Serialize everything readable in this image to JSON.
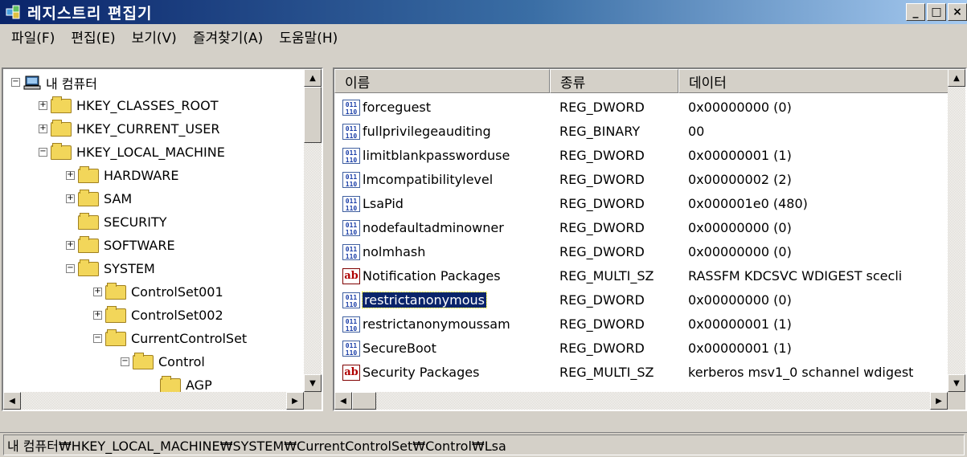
{
  "window": {
    "title": "레지스트리 편집기",
    "buttons": {
      "minimize": "_",
      "maximize": "□",
      "close": "×"
    }
  },
  "menu": [
    "파일(F)",
    "편집(E)",
    "보기(V)",
    "즐겨찾기(A)",
    "도움말(H)"
  ],
  "tree": [
    {
      "label": "내 컴퓨터",
      "expander": "−",
      "icon": "computer-icon",
      "depth": 0
    },
    {
      "label": "HKEY_CLASSES_ROOT",
      "expander": "+",
      "icon": "folder-icon",
      "depth": 1
    },
    {
      "label": "HKEY_CURRENT_USER",
      "expander": "+",
      "icon": "folder-icon",
      "depth": 1
    },
    {
      "label": "HKEY_LOCAL_MACHINE",
      "expander": "−",
      "icon": "folder-icon",
      "depth": 1
    },
    {
      "label": "HARDWARE",
      "expander": "+",
      "icon": "folder-icon",
      "depth": 2
    },
    {
      "label": "SAM",
      "expander": "+",
      "icon": "folder-icon",
      "depth": 2
    },
    {
      "label": "SECURITY",
      "expander": "",
      "icon": "folder-icon",
      "depth": 2
    },
    {
      "label": "SOFTWARE",
      "expander": "+",
      "icon": "folder-icon",
      "depth": 2
    },
    {
      "label": "SYSTEM",
      "expander": "−",
      "icon": "folder-icon",
      "depth": 2
    },
    {
      "label": "ControlSet001",
      "expander": "+",
      "icon": "folder-icon",
      "depth": 3
    },
    {
      "label": "ControlSet002",
      "expander": "+",
      "icon": "folder-icon",
      "depth": 3
    },
    {
      "label": "CurrentControlSet",
      "expander": "−",
      "icon": "folder-icon",
      "depth": 3
    },
    {
      "label": "Control",
      "expander": "−",
      "icon": "folder-icon",
      "depth": 4
    },
    {
      "label": "AGP",
      "expander": "",
      "icon": "folder-icon",
      "depth": 5
    }
  ],
  "list": {
    "columns": [
      "이름",
      "종류",
      "데이터"
    ],
    "rows": [
      {
        "name": "forceguest",
        "type": "REG_DWORD",
        "data": "0x00000000 (0)",
        "icon": "binary-value-icon"
      },
      {
        "name": "fullprivilegeauditing",
        "type": "REG_BINARY",
        "data": "00",
        "icon": "binary-value-icon"
      },
      {
        "name": "limitblankpassworduse",
        "type": "REG_DWORD",
        "data": "0x00000001 (1)",
        "icon": "binary-value-icon"
      },
      {
        "name": "lmcompatibilitylevel",
        "type": "REG_DWORD",
        "data": "0x00000002 (2)",
        "icon": "binary-value-icon"
      },
      {
        "name": "LsaPid",
        "type": "REG_DWORD",
        "data": "0x000001e0 (480)",
        "icon": "binary-value-icon"
      },
      {
        "name": "nodefaultadminowner",
        "type": "REG_DWORD",
        "data": "0x00000000 (0)",
        "icon": "binary-value-icon"
      },
      {
        "name": "nolmhash",
        "type": "REG_DWORD",
        "data": "0x00000000 (0)",
        "icon": "binary-value-icon"
      },
      {
        "name": "Notification Packages",
        "type": "REG_MULTI_SZ",
        "data": "RASSFM KDCSVC WDIGEST scecli",
        "icon": "string-value-icon"
      },
      {
        "name": "restrictanonymous",
        "type": "REG_DWORD",
        "data": "0x00000000 (0)",
        "icon": "binary-value-icon",
        "selected": true
      },
      {
        "name": "restrictanonymoussam",
        "type": "REG_DWORD",
        "data": "0x00000001 (1)",
        "icon": "binary-value-icon"
      },
      {
        "name": "SecureBoot",
        "type": "REG_DWORD",
        "data": "0x00000001 (1)",
        "icon": "binary-value-icon"
      },
      {
        "name": "Security Packages",
        "type": "REG_MULTI_SZ",
        "data": "kerberos msv1_0 schannel wdigest",
        "icon": "string-value-icon"
      }
    ]
  },
  "status": "내 컴퓨터₩HKEY_LOCAL_MACHINE₩SYSTEM₩CurrentControlSet₩Control₩Lsa",
  "colors": {
    "titlebar": "#0a246a",
    "selection": "#0a246a",
    "face": "#d4d0c8"
  }
}
